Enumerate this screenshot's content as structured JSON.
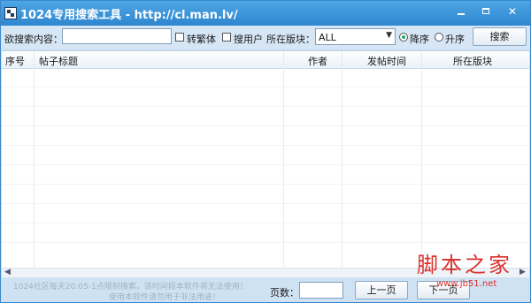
{
  "window": {
    "title": "1024专用搜索工具 - http://cl.man.lv/",
    "controls": {
      "minimize": "minimize",
      "maximize": "maximize",
      "close": "✕"
    }
  },
  "toolbar": {
    "search_label": "欲搜索内容：",
    "search_value": "",
    "traditional_label": "转繁体",
    "traditional_checked": false,
    "search_user_label": "搜用户",
    "section_label": "所在版块：",
    "section_value": "ALL",
    "sort_desc_label": "降序",
    "sort_asc_label": "升序",
    "sort_selected": "desc",
    "search_button": "搜索"
  },
  "table": {
    "columns": [
      "序号",
      "帖子标题",
      "作者",
      "发帖时间",
      "所在版块"
    ],
    "rows": []
  },
  "footer": {
    "notice_line1": "1024社区每天20:05-1点限制搜索，该时间段本软件将无法使用！",
    "notice_line2": "使用本软件请勿用于非法用途！",
    "page_label": "页数：",
    "page_value": "",
    "prev_button": "上一页",
    "next_button": "下一页"
  },
  "watermark": {
    "site_name": "脚本之家",
    "site_url": "www.jb51.net"
  },
  "colors": {
    "title_bar": "#2e86cf",
    "window_bg": "#cfe2f3",
    "watermark": "#d9312b"
  },
  "icons": [
    "app-icon",
    "minimize-icon",
    "maximize-icon",
    "close-icon",
    "dropdown-arrow-icon",
    "scroll-left-icon",
    "scroll-right-icon"
  ]
}
